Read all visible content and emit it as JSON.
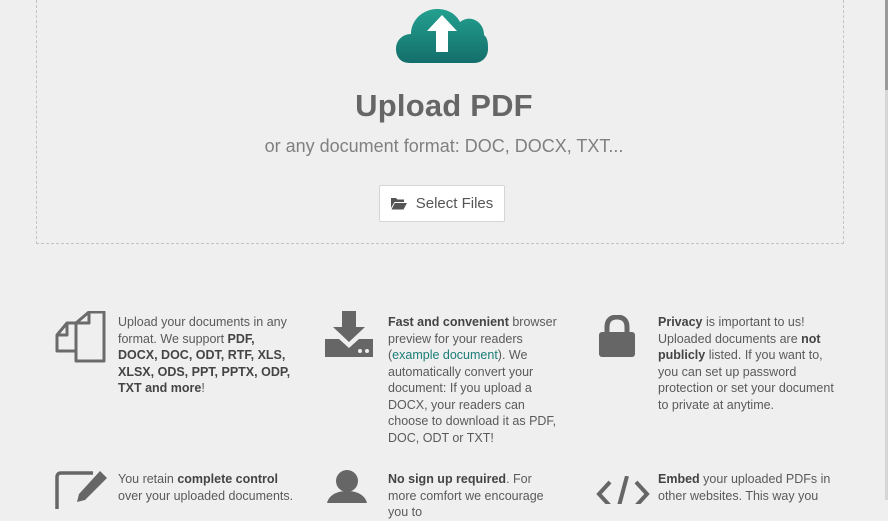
{
  "upload": {
    "title": "Upload PDF",
    "subtitle": "or any document format: DOC, DOCX, TXT...",
    "select_label": "Select Files",
    "accent_color": "#1b8a7f"
  },
  "features": [
    {
      "icon": "documents-icon",
      "parts": [
        "Upload your documents in any format. We support ",
        "PDF, DOCX, DOC, ODT, RTF, XLS, XLSX, ODS, PPT, PPTX, ODP, TXT and more",
        "!"
      ]
    },
    {
      "icon": "download-icon",
      "parts": [
        "Fast and convenient",
        " browser preview for your readers (",
        "example document",
        "). We automatically convert your document: If you upload a DOCX, your readers can choose to download it as PDF, DOC, ODT or TXT!"
      ]
    },
    {
      "icon": "lock-icon",
      "parts": [
        "Privacy",
        " is important to us! Uploaded documents are ",
        "not publicly",
        " listed. If you want to, you can set up password protection or set your document to private at anytime."
      ]
    },
    {
      "icon": "edit-icon",
      "parts": [
        "You retain ",
        "complete control",
        " over your uploaded documents."
      ]
    },
    {
      "icon": "user-icon",
      "parts": [
        "No sign up required",
        ". For more comfort we encourage you to"
      ]
    },
    {
      "icon": "code-icon",
      "parts": [
        "Embed",
        " your uploaded PDFs in other websites. This way you"
      ]
    }
  ]
}
